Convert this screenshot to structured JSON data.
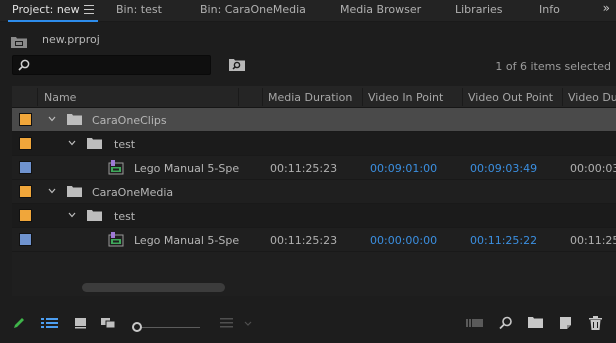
{
  "tabs": [
    {
      "label": "Project: new",
      "active": true
    },
    {
      "label": "Bin: test",
      "active": false
    },
    {
      "label": "Bin: CaraOneMedia",
      "active": false
    },
    {
      "label": "Media Browser",
      "active": false
    },
    {
      "label": "Libraries",
      "active": false
    },
    {
      "label": "Info",
      "active": false
    }
  ],
  "more_label": "»",
  "project": {
    "file_name": "new.prproj"
  },
  "search": {
    "value": "",
    "placeholder": ""
  },
  "status": {
    "items_selected": "1 of 6 items selected"
  },
  "columns": [
    "Name",
    "Media Duration",
    "Video In Point",
    "Video Out Point",
    "Video Du"
  ],
  "rows": [
    {
      "name": "CaraOneClips",
      "type": "bin",
      "label_color": "#f0a63a",
      "duration": "",
      "in": "",
      "out": "",
      "vdur": "",
      "selected": true
    },
    {
      "name": "test",
      "type": "bin",
      "label_color": "#f0a63a",
      "duration": "",
      "in": "",
      "out": "",
      "vdur": "",
      "selected": false
    },
    {
      "name": "Lego Manual 5-Spe",
      "type": "sequence",
      "label_color": "#6f93cf",
      "duration": "00:11:25:23",
      "in": "00:09:01:00",
      "out": "00:09:03:49",
      "vdur": "00:00:03",
      "selected": false
    },
    {
      "name": "CaraOneMedia",
      "type": "bin",
      "label_color": "#f0a63a",
      "duration": "",
      "in": "",
      "out": "",
      "vdur": "",
      "selected": false
    },
    {
      "name": "test",
      "type": "bin",
      "label_color": "#f0a63a",
      "duration": "",
      "in": "",
      "out": "",
      "vdur": "",
      "selected": false
    },
    {
      "name": "Lego Manual 5-Spe",
      "type": "sequence",
      "label_color": "#6f93cf",
      "duration": "00:11:25:23",
      "in": "00:00:00:00",
      "out": "00:11:25:22",
      "vdur": "00:11:25",
      "selected": false
    }
  ],
  "colors": {
    "accent": "#2d8ceb",
    "bin_label": "#f0a63a",
    "sequence_label": "#6f93cf",
    "timecode_blue": "#3b8fe0",
    "pencil_green": "#3fb54a"
  },
  "toolbar_icons": [
    "pencil-icon",
    "list-view-icon",
    "icon-view-icon",
    "freeform-view-icon",
    "zoom-slider",
    "sort-icon",
    "automate-to-sequence-icon",
    "find-icon",
    "new-bin-icon",
    "new-item-icon",
    "clear-icon"
  ]
}
